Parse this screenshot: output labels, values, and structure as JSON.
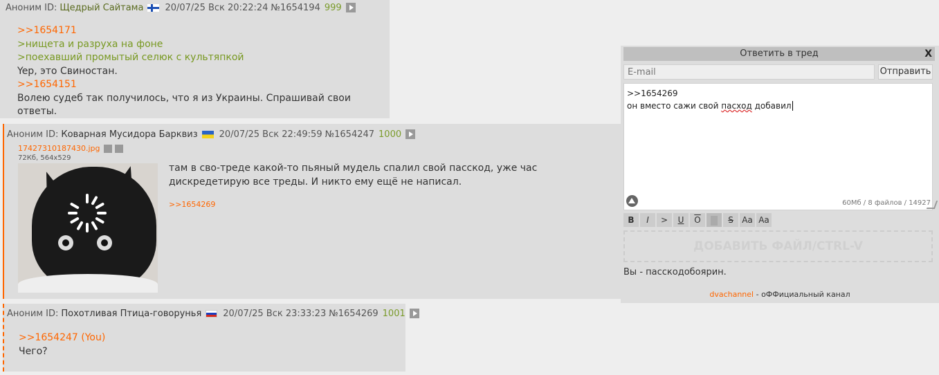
{
  "posts": [
    {
      "anon": "Аноним",
      "id_label": "ID:",
      "name": "Щедрый Сайтама",
      "flag": "fi",
      "date": "20/07/25 Вск 20:22:24",
      "num": "№1654194",
      "count": "999",
      "lines": [
        {
          "type": "reply",
          "text": ">>1654171"
        },
        {
          "type": "quote",
          "text": ">нищета и разруха на фоне"
        },
        {
          "type": "quote",
          "text": ">поехавший промытый селюк с культяпкой"
        },
        {
          "type": "text",
          "text": "Yep, это Свиностан."
        },
        {
          "type": "reply",
          "text": ">>1654151"
        },
        {
          "type": "text",
          "text": "Волею судеб так получилось, что я из Украины. Спрашивай свои ответы."
        }
      ]
    },
    {
      "anon": "Аноним",
      "id_label": "ID:",
      "name": "Коварная Мусидора Барквиз",
      "flag": "ua",
      "date": "20/07/25 Вск 22:49:59",
      "num": "№1654247",
      "count": "1000",
      "file": {
        "name": "17427310187430.jpg",
        "meta": "72Кб, 564x529"
      },
      "text": "там в сво-треде какой-то пьяный мудель спалил свой пасскод, уже час дискредетирую все треды. И никто ему ещё не написал.",
      "backlink": ">>1654269"
    },
    {
      "anon": "Аноним",
      "id_label": "ID:",
      "name": "Похотливая Птица-говорунья",
      "flag": "ru",
      "date": "20/07/25 Вск 23:33:23",
      "num": "№1654269",
      "count": "1001",
      "reply": ">>1654247",
      "you": "(You)",
      "text": "Чего?"
    }
  ],
  "form": {
    "title": "Ответить в тред",
    "close": "X",
    "email_placeholder": "E-mail",
    "send": "Отправить",
    "message_line1": ">>1654269",
    "message_before": "он вместо сажи свой ",
    "message_misspelled": "пасход",
    "message_after": " добавил",
    "quota": "60Мб / 8 файлов / 14927",
    "toolbar": [
      "B",
      "I",
      ">",
      "U",
      "O",
      "",
      "S",
      "Aa",
      "Aa"
    ],
    "add_file": "ДОБАВИТЬ ФАЙЛ/CTRL-V",
    "passcode": "Вы - пасскодобоярин.",
    "footer_link": "dvachannel",
    "footer_text": " - оФФициальный канал"
  },
  "colors": {
    "accent": "#ff6600",
    "quote": "#789922",
    "count": "#7a9b2a"
  }
}
